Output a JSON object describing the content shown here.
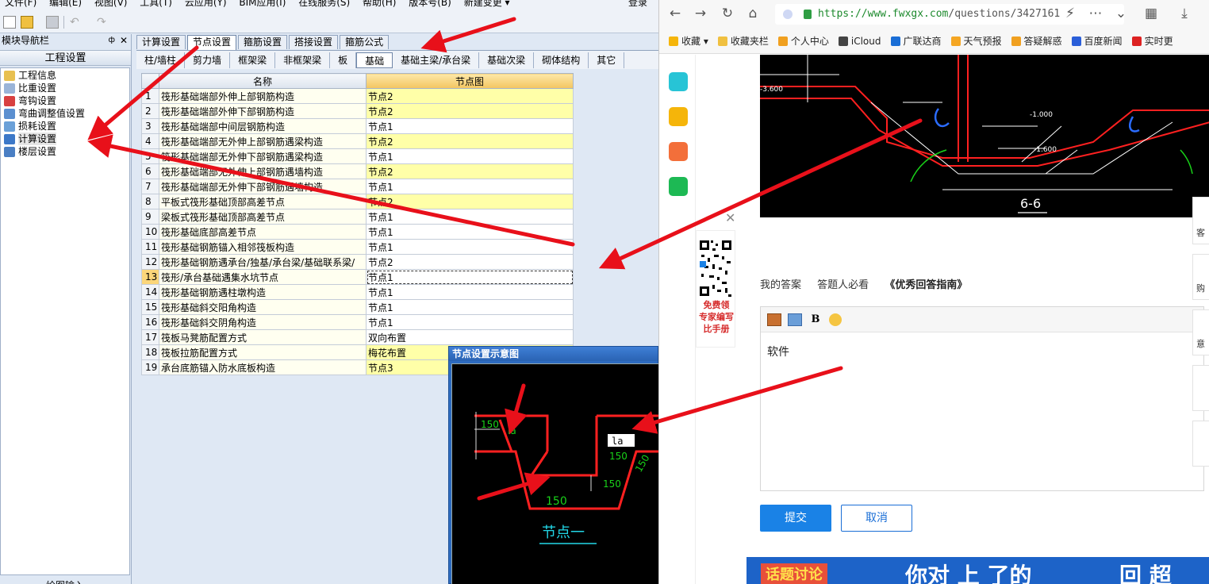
{
  "app": {
    "menu": [
      "文件(F)",
      "编辑(E)",
      "视图(V)",
      "工具(T)",
      "云应用(Y)",
      "BIM应用(I)",
      "在线服务(S)",
      "帮助(H)",
      "版本号(B)",
      "新建变更 ▾"
    ],
    "login": "登录",
    "nav": {
      "header": "模块导航栏",
      "pin": "ф",
      "close": "✕",
      "title": "工程设置",
      "items": [
        "工程信息",
        "比重设置",
        "弯钩设置",
        "弯曲调整值设置",
        "损耗设置",
        "计算设置",
        "楼层设置"
      ],
      "selected_index": 5,
      "bottom_tab": "绘图输入"
    },
    "tabs_top": [
      "计算设置",
      "节点设置",
      "箍筋设置",
      "搭接设置",
      "箍筋公式"
    ],
    "tabs_top_active": 1,
    "tabs_sub": [
      "柱/墙柱",
      "剪力墙",
      "框架梁",
      "非框架梁",
      "板",
      "基础",
      "基础主梁/承台梁",
      "基础次梁",
      "砌体结构",
      "其它"
    ],
    "tabs_sub_active": 5,
    "grid": {
      "headers": [
        "名称",
        "节点图"
      ],
      "rows": [
        {
          "n": "1",
          "name": "筏形基础端部外伸上部钢筋构造",
          "val": "节点2",
          "hl": true
        },
        {
          "n": "2",
          "name": "筏形基础端部外伸下部钢筋构造",
          "val": "节点2",
          "hl": true
        },
        {
          "n": "3",
          "name": "筏形基础端部中间层钢筋构造",
          "val": "节点1",
          "hl": false
        },
        {
          "n": "4",
          "name": "筏形基础端部无外伸上部钢筋遇梁构造",
          "val": "节点2",
          "hl": true
        },
        {
          "n": "5",
          "name": "筏形基础端部无外伸下部钢筋遇梁构造",
          "val": "节点1",
          "hl": false
        },
        {
          "n": "6",
          "name": "筏形基础端部无外伸上部钢筋遇墙构造",
          "val": "节点2",
          "hl": true
        },
        {
          "n": "7",
          "name": "筏形基础端部无外伸下部钢筋遇墙构造",
          "val": "节点1",
          "hl": false
        },
        {
          "n": "8",
          "name": "平板式筏形基础顶部高差节点",
          "val": "节点2",
          "hl": true
        },
        {
          "n": "9",
          "name": "梁板式筏形基础顶部高差节点",
          "val": "节点1",
          "hl": false
        },
        {
          "n": "10",
          "name": "筏形基础底部高差节点",
          "val": "节点1",
          "hl": false
        },
        {
          "n": "11",
          "name": "筏形基础钢筋锚入相邻筏板构造",
          "val": "节点1",
          "hl": false
        },
        {
          "n": "12",
          "name": "筏形基础钢筋遇承台/独基/承台梁/基础联系梁/",
          "val": "节点2",
          "hl": false
        },
        {
          "n": "13",
          "name": "筏形/承台基础遇集水坑节点",
          "val": "节点1",
          "hl": false,
          "current": true
        },
        {
          "n": "14",
          "name": "筏形基础钢筋遇柱墩构造",
          "val": "节点1",
          "hl": false
        },
        {
          "n": "15",
          "name": "筏形基础斜交阳角构造",
          "val": "节点1",
          "hl": false
        },
        {
          "n": "16",
          "name": "筏形基础斜交阴角构造",
          "val": "节点1",
          "hl": false
        },
        {
          "n": "17",
          "name": "筏板马凳筋配置方式",
          "val": "双向布置",
          "hl": false
        },
        {
          "n": "18",
          "name": "筏板拉筋配置方式",
          "val": "梅花布置",
          "hl": true
        },
        {
          "n": "19",
          "name": "承台底筋锚入防水底板构造",
          "val": "节点3",
          "hl": true
        }
      ]
    },
    "dialog": {
      "title": "节点设置示意图",
      "caption": "节点一",
      "labels": {
        "la_top": "la",
        "d150_a": "150",
        "d150_b": "150",
        "d150_c": "150",
        "d150_d": "150",
        "d150_e": "150",
        "la_box": "la"
      }
    }
  },
  "browser": {
    "url_host": "https://www.fwxgx.com",
    "url_path": "/questions/3427161",
    "bookmarks": [
      "收藏 ▾",
      "收藏夹栏",
      "个人中心",
      "iCloud",
      "广联达商",
      "天气预报",
      "答疑解惑",
      "百度新闻",
      "实时更"
    ],
    "cad_labels": {
      "section": "6-6",
      "l1": "-3.600",
      "l2": "-1.000",
      "l3": "-1.600"
    },
    "qr_close": "✕",
    "qr_promo": [
      "免费领",
      "专家编写",
      "比手册"
    ],
    "answer_tabs": [
      "我的答案",
      "答题人必看"
    ],
    "answer_guide": "《优秀回答指南》",
    "editor_bold": "B",
    "editor_content": "软件",
    "submit": "提交",
    "cancel": "取消",
    "float_labels": [
      "客",
      "购",
      "意"
    ],
    "banner_left": "话题讨论",
    "banner_mid": "你对 上 了的",
    "banner_right": "回 超"
  },
  "colors": {
    "arrow": "#e8101a",
    "accent": "#1a82e6",
    "cad_red": "#ff2020",
    "cad_green": "#19d219",
    "cad_cyan": "#22d8e8"
  }
}
